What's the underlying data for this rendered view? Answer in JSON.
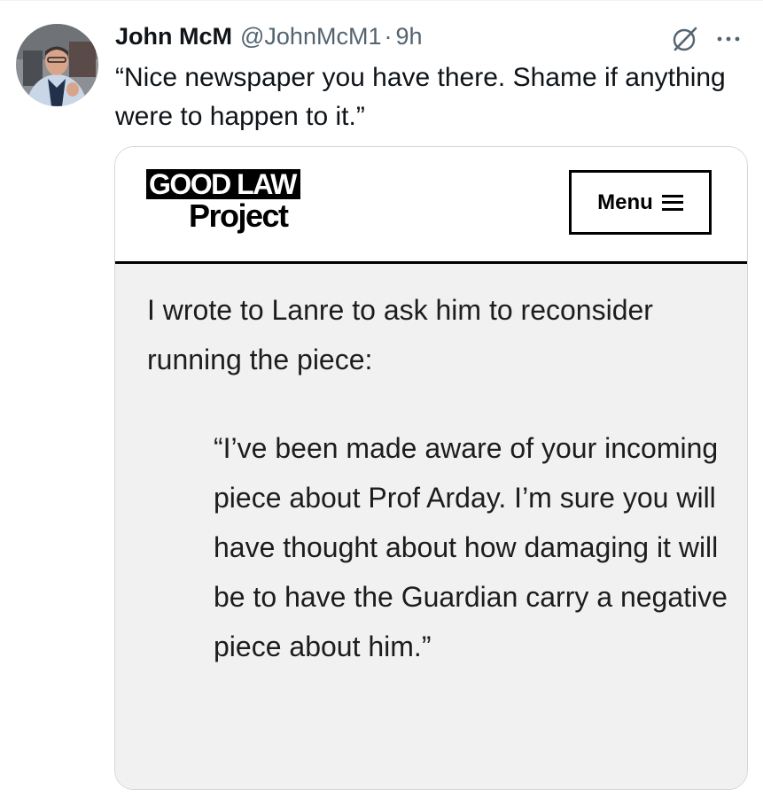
{
  "tweet": {
    "author_name": "John McM",
    "author_handle": "@JohnMcM1",
    "separator": "·",
    "time": "9h",
    "text": "“Nice newspaper you have there. Shame if anything were to happen to it.”"
  },
  "icons": {
    "avatar": "user-photo",
    "grok": "grok-icon",
    "more": "more-icon"
  },
  "embedded_image": {
    "site": {
      "logo_line1": "GOOD LAW",
      "logo_line2": "Project",
      "menu_label": "Menu"
    },
    "article": {
      "intro": "I wrote to Lanre to ask him to reconsider running the piece:",
      "quote": "“I’ve been made aware of your incoming piece about Prof Arday. I’m sure you will have thought about how damaging it will be to have the Guardian carry a negative piece about him.”"
    }
  },
  "colors": {
    "text_primary": "#0f1419",
    "text_secondary": "#536471",
    "border": "#cfd9de",
    "article_bg": "#f1f1f1"
  }
}
